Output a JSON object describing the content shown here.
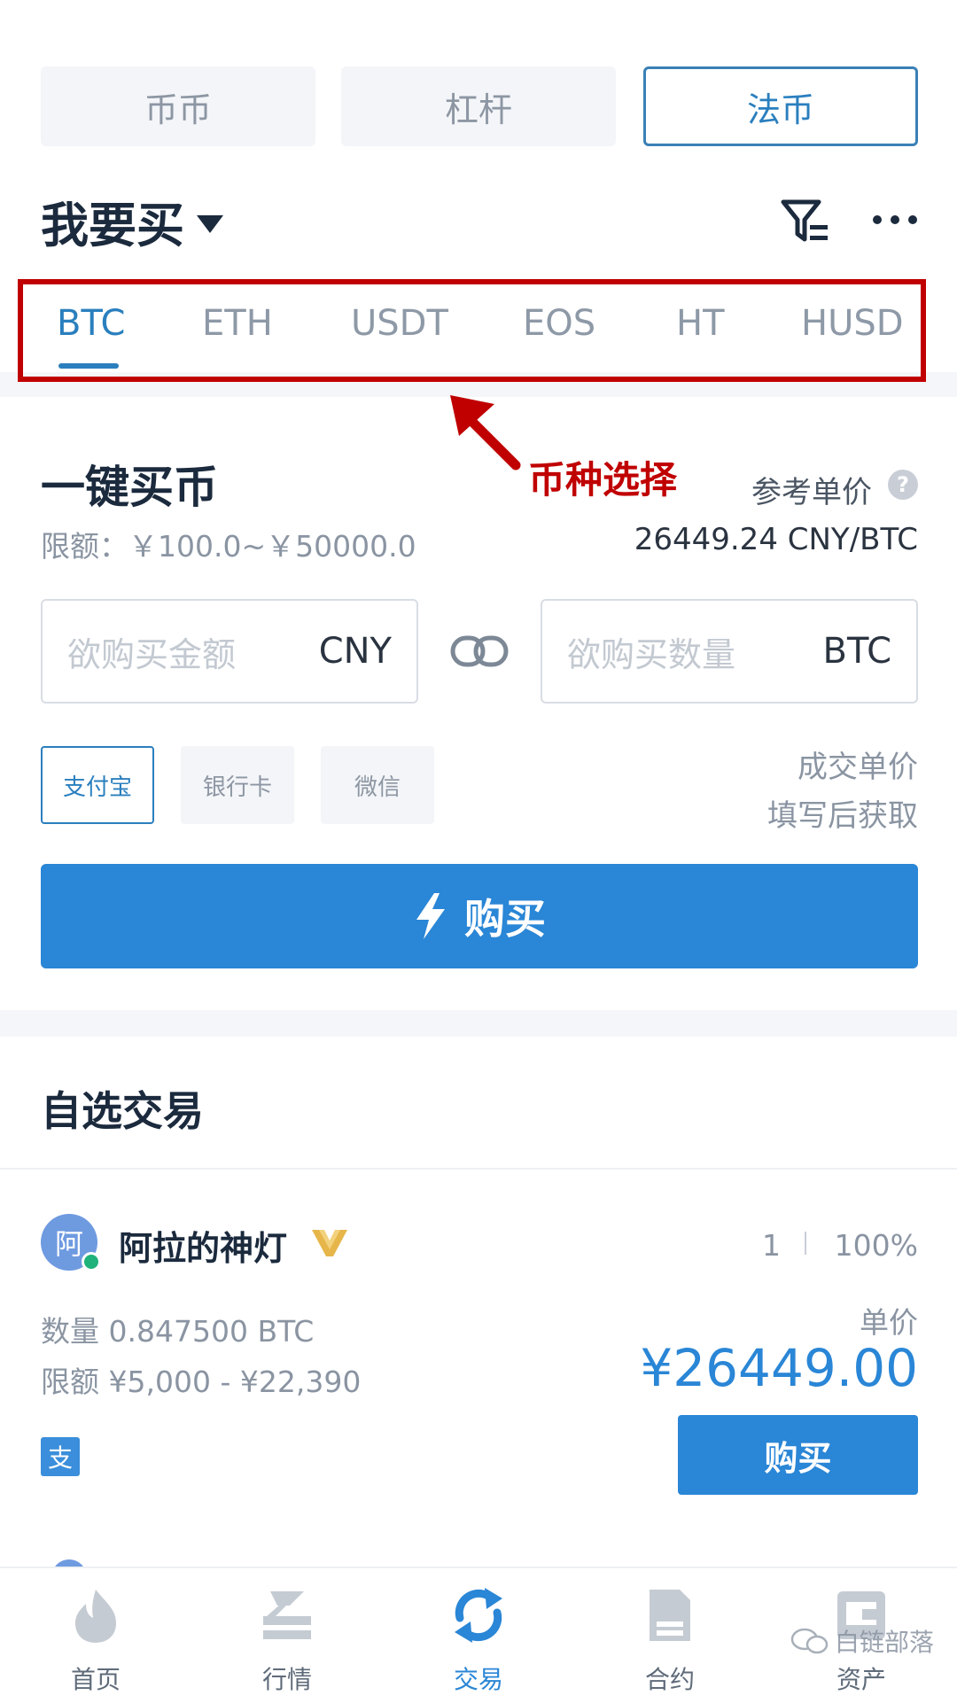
{
  "top_tabs": [
    "币币",
    "杠杆",
    "法币"
  ],
  "mode_title": "我要买",
  "coins": [
    "BTC",
    "ETH",
    "USDT",
    "EOS",
    "HT",
    "HUSD"
  ],
  "annotation": "币种选择",
  "quick_buy": {
    "title": "一键买币",
    "limit": "限额：￥100.0~￥50000.0",
    "ref_price_label": "参考单价",
    "ref_price_value": "26449.24 CNY/BTC",
    "amount_placeholder": "欲购买金额",
    "amount_unit": "CNY",
    "quantity_placeholder": "欲购买数量",
    "quantity_unit": "BTC",
    "pay_methods": [
      "支付宝",
      "银行卡",
      "微信"
    ],
    "deal_price_line1": "成交单价",
    "deal_price_line2": "填写后获取",
    "buy_label": "购买"
  },
  "selected_trade": {
    "title": "自选交易",
    "merchant": {
      "avatar_char": "阿",
      "name": "阿拉的神灯",
      "orders": "1",
      "rate": "100%",
      "quantity": "数量 0.847500 BTC",
      "limit": "限额 ¥5,000 - ¥22,390",
      "pay_badge": "支",
      "price_label": "单价",
      "price": "¥26449.00",
      "buy_label": "购买"
    }
  },
  "tab_bar": [
    "首页",
    "行情",
    "交易",
    "合约",
    "资产"
  ],
  "watermark": "白链部落",
  "colors": {
    "accent": "#2a86d6",
    "annotation": "#c00000",
    "online": "#1fb27a",
    "vip": "#e6b64a"
  }
}
